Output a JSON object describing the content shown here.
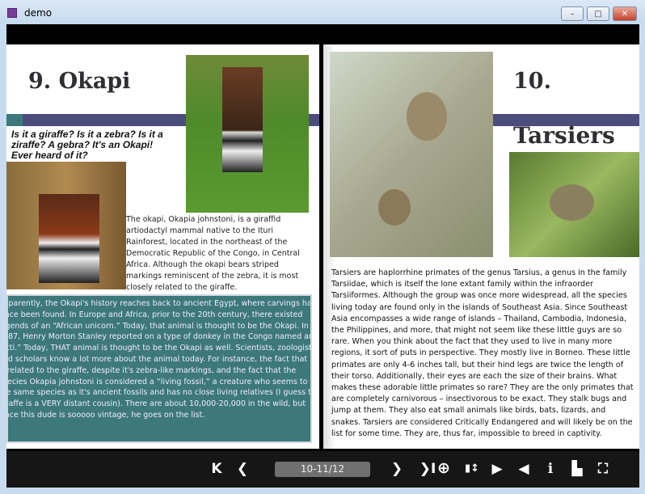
{
  "window": {
    "title": "demo",
    "min": "–",
    "max": "□",
    "close": "✕"
  },
  "left_page": {
    "title": "9. Okapi",
    "question": "Is it a giraffe?  Is it a zebra?  Is it a ziraffe?  A gebra?  It's an Okapi!  Ever heard of it?",
    "intro": "The okapi, Okapia johnstoni, is a giraffid artiodactyl mammal native to the Ituri Rainforest, located in the northeast of the Democratic Republic of the Congo, in Central Africa. Although the okapi bears striped markings reminiscent of the zebra, it is most closely related to the giraffe.",
    "history": "Apparently, the Okapi's history reaches back to ancient Egypt, where carvings have since been found.  In Europe and Africa, prior to the 20th century, there existed legends of an “African unicorn.”  Today, that animal is thought to be the Okapi.  In 1887, Henry Morton Stanley reported on a type of donkey in the Congo named an “Atti.”  Today, THAT animal is thought to be the Okapi as well.  Scientists, zoologists, and scholars know a lot more about the animal today.  For instance, the fact that it is related to the giraffe, despite it's zebra-like markings, and the fact that the species Okapia johnstoni is considered a “living fossil,” a creature who seems to be the same species as it's ancient fossils and has no close living relatives (I guess the giraffe is a VERY distant cousin).  There are about 10,000-20,000 in the wild, but since this dude is sooooo vintage, he goes on the list."
  },
  "right_page": {
    "number": "10.",
    "title": "Tarsiers",
    "lines": [
      "Tarsiers are haplorrhine primates of the genus Tarsius, a genus in the family",
      "Tarsiidae, which is itself the lone extant family within the infraorder",
      "Tarsiiformes. Although the group was once more widespread, all the species",
      "living today are found only in the islands of Southeast Asia.  Since Southeast",
      "Asia encompasses a wide range of islands – Thailand, Cambodia, Indonesia,",
      "the Philippines, and more, that might not seem like these little guys are so",
      "rare.  When you think about the fact that they used to live in many more",
      "regions, it sort of puts in perspective.  They mostly live in Borneo.  These little",
      "primates are only 4-6 inches tall, but their hind legs are twice the length of",
      "their torso.  Additionally, their eyes are each the size of their brains.  What",
      "makes these adorable little primates so rare?  They are the only primates that",
      "are completely carnivorous – insectivorous to be exact.  They stalk bugs and",
      "jump at them.  They also eat small animals like birds, bats, lizards, and",
      "snakes.  Tarsiers are considered Critically Endangered and will likely be on the",
      "list for some time.  They are, thus far, impossible to breed in captivity."
    ]
  },
  "toolbar": {
    "first": "K",
    "prev": "❮",
    "page": "10-11/12",
    "next": "❯",
    "last": "❯I",
    "zoom": "⊕",
    "fit": "▮↕",
    "play": "▶",
    "sound": "◀",
    "info": "i",
    "print": "▙",
    "fullscreen": "⛶"
  }
}
